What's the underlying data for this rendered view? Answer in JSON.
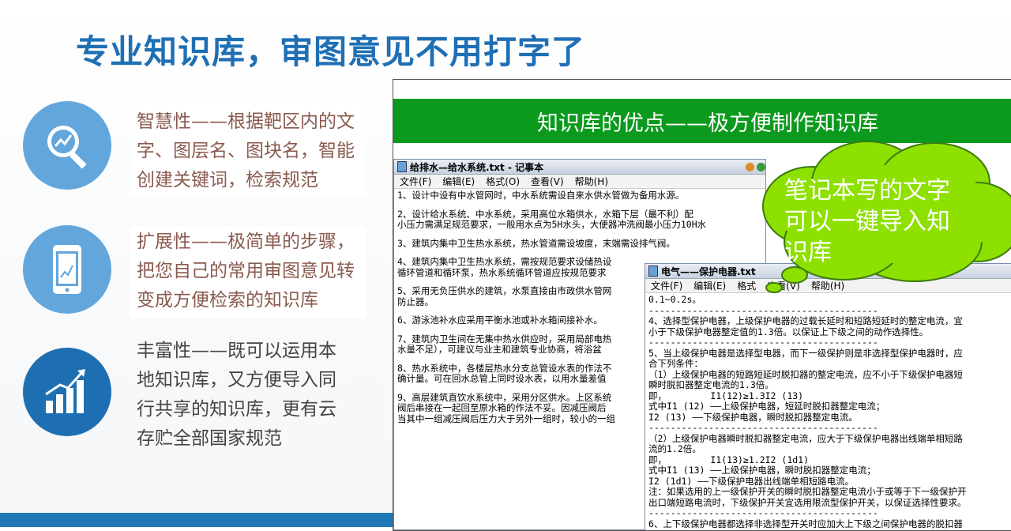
{
  "slide": {
    "title": "专业知识库，审图意见不用打字了"
  },
  "features": [
    {
      "icon": "search-chart-icon",
      "text": "智慧性——根据靶区内的文字、图层名、图块名，智能创建关键词，检索规范"
    },
    {
      "icon": "phone-chart-icon",
      "text": "扩展性——极简单的步骤，把您自己的常用审图意见转变成方便检索的知识库"
    },
    {
      "icon": "growth-chart-icon",
      "text": "丰富性——既可以运用本地知识库，又方便导入同行共享的知识库，更有云存贮全部国家规范"
    }
  ],
  "panel": {
    "banner": "知识库的优点——极方便制作知识库",
    "callout": "笔记本写的文字可以一键导入知识库"
  },
  "notepad1": {
    "title": "给排水—给水系统.txt - 记事本",
    "menu": [
      "文件(F)",
      "编辑(E)",
      "格式(O)",
      "查看(V)",
      "帮助(H)"
    ],
    "lines": [
      "1、设计中设有中水管网时，中水系统需设自来水供水管做为备用水源。",
      "",
      "2、设计给水系统、中水系统，采用高位水箱供水，水箱下层（最不利）配",
      "小压力需满足规范要求，一般用水点为5H水头，大便器冲洗阀最小压力10H水",
      "",
      "3、建筑内集中卫生热水系统，热水管道需设坡度，末端需设排气阀。",
      "",
      "4、建筑内集中卫生热水系统，需按规范要求设储热设",
      "循环管道和循环泵，热水系统循环管道应按规范要求",
      "",
      "5、采用无负压供水的建筑，水泵直接由市政供水管网",
      "防止器。",
      "",
      "6、游泳池补水应采用平衡水池或补水箱间接补水。",
      "",
      "7、建筑内卫生间在无集中热水供应时，采用局部电热",
      "水量不足），可建议与业主和建筑专业协商，将浴盆",
      "",
      "8、热水系统中，各楼层热水分支总管设水表的作法不",
      "确计量。可在回水总管上同时设水表，以用水量差值",
      "",
      "9、高层建筑直饮水系统中，采用分区供水。上区系统",
      "阀后串接在一起回至原水箱的作法不妥。因减压阀后",
      "当其中一组减压阀后压力大于另外一组时，较小的一组"
    ]
  },
  "notepad2": {
    "title": "电气——保护电器.txt",
    "menu": [
      "文件(F)",
      "编辑(E)",
      "格式",
      "查看(V)",
      "帮助(H)"
    ],
    "lines": [
      "0.1~0.2s。",
      "------------------------------------------",
      "4、选择型保护电器，上级保护电器的过载长延时和短路短延时的整定电流，宜",
      "小于下级保护电器整定值的1.3倍。以保证上下级之间的动作选择性。",
      "------------------------------------------",
      "5、当上级保护电器是选择型电器，而下一级保护则是非选择型保护电器时，应",
      "合下列条件：",
      "（1）上级保护电器的短路短延时脱扣器的整定电流，应不小于下级保护电器短",
      "瞬时脱扣器整定电流的1.3倍。",
      "即，        I1(12)≥1.3I2 (13)",
      "式中I1 (12) ——上级保护电器，短延时脱扣器整定电流；",
      "I2 (13) ——下级保护电器，瞬时脱扣器整定电流。",
      "------------------------------------------",
      "（2）上级保护电器瞬时脱扣器整定电流，应大于下级保护电器出线端单相短路",
      "流的1.2倍。",
      "即，        I1(13)≥1.2I2 (1d1)",
      "式中I1 (13) ——上级保护电器，瞬时脱扣器整定电流；",
      "I2 (1d1) ——下级保护电器出线端单相短路电流。",
      "注：如果选用的上一级保护开关的瞬时脱扣器整定电流小于或等于下一级保护开",
      "出口端短路电流时，下级保护开关宜选用限流型保护开关，以保证选择性要求。",
      "------------------------------------------",
      "6、上下级保护电器都选择非选择型开关时应加大上下级之间保护电器的脱扣器"
    ]
  },
  "colors": {
    "title_blue": "#1f6fb5",
    "banner_green": "#0b9a1d",
    "cloud_green": "#8ee000",
    "feature_text": "#8a5a4e"
  }
}
